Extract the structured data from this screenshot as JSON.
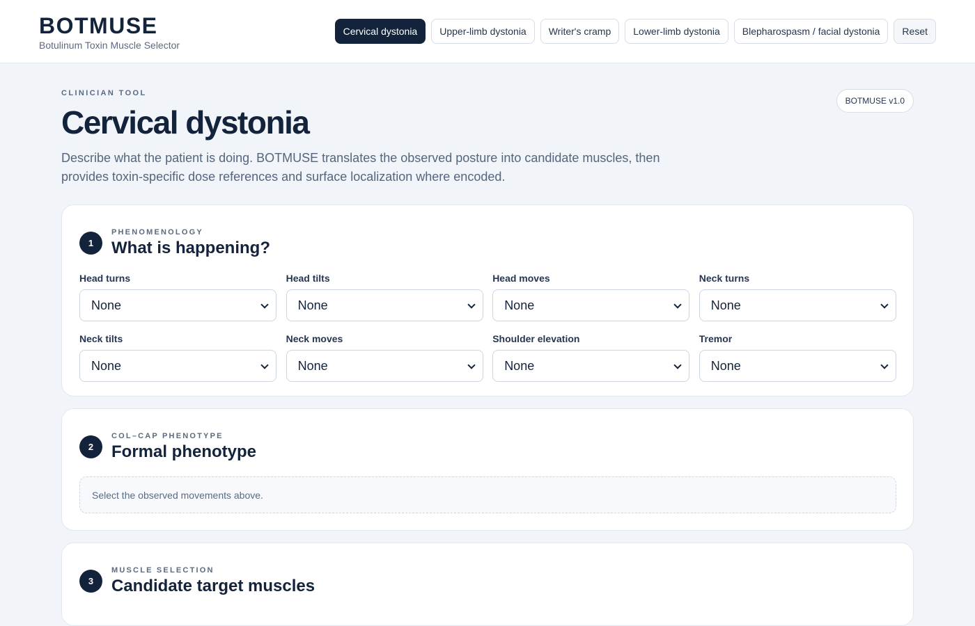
{
  "header": {
    "brand": "BOTMUSE",
    "subtitle": "Botulinum Toxin Muscle Selector",
    "nav": [
      {
        "label": "Cervical dystonia",
        "active": true
      },
      {
        "label": "Upper-limb dystonia",
        "active": false
      },
      {
        "label": "Writer's cramp",
        "active": false
      },
      {
        "label": "Lower-limb dystonia",
        "active": false
      },
      {
        "label": "Blepharospasm / facial dystonia",
        "active": false
      }
    ],
    "reset_label": "Reset"
  },
  "intro": {
    "eyebrow": "CLINICIAN TOOL",
    "title": "Cervical dystonia",
    "description": "Describe what the patient is doing. BOTMUSE translates the observed posture into candidate muscles, then provides toxin-specific dose references and surface localization where encoded.",
    "version": "BOTMUSE v1.0"
  },
  "steps": [
    {
      "number": "1",
      "eyebrow": "PHENOMENOLOGY",
      "title": "What is happening?",
      "fields": [
        {
          "label": "Head turns",
          "value": "None"
        },
        {
          "label": "Head tilts",
          "value": "None"
        },
        {
          "label": "Head moves",
          "value": "None"
        },
        {
          "label": "Neck turns",
          "value": "None"
        },
        {
          "label": "Neck tilts",
          "value": "None"
        },
        {
          "label": "Neck moves",
          "value": "None"
        },
        {
          "label": "Shoulder elevation",
          "value": "None"
        },
        {
          "label": "Tremor",
          "value": "None"
        }
      ]
    },
    {
      "number": "2",
      "eyebrow": "COL–CAP PHENOTYPE",
      "title": "Formal phenotype",
      "empty_message": "Select the observed movements above."
    },
    {
      "number": "3",
      "eyebrow": "MUSCLE SELECTION",
      "title": "Candidate target muscles"
    }
  ],
  "colors": {
    "primary": "#13233b",
    "background": "#f1f4f9",
    "muted_text": "#5a6a80",
    "border": "#e2e7ef"
  },
  "icons": {
    "select_arrow": "chevron-down-icon"
  }
}
